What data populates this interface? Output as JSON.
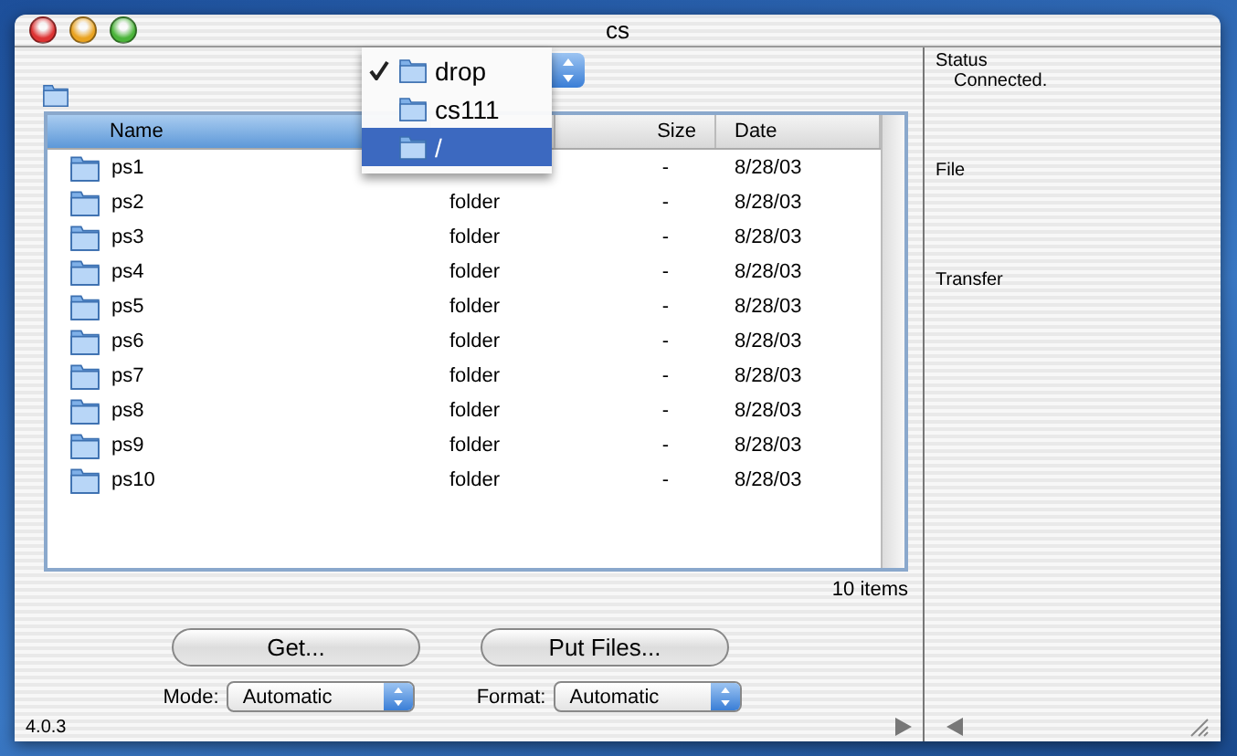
{
  "window": {
    "title": "cs"
  },
  "path_menu": [
    {
      "label": "drop",
      "checked": true,
      "selected": false
    },
    {
      "label": "cs111",
      "checked": false,
      "selected": false
    },
    {
      "label": "/",
      "checked": false,
      "selected": true
    }
  ],
  "table": {
    "columns": [
      "Name",
      "Size",
      "Date"
    ],
    "rows": [
      {
        "name": "ps1",
        "size": "-",
        "date": "8/28/03"
      },
      {
        "name": "ps2",
        "kind": "folder",
        "size": "-",
        "date": "8/28/03"
      },
      {
        "name": "ps3",
        "kind": "folder",
        "size": "-",
        "date": "8/28/03"
      },
      {
        "name": "ps4",
        "kind": "folder",
        "size": "-",
        "date": "8/28/03"
      },
      {
        "name": "ps5",
        "kind": "folder",
        "size": "-",
        "date": "8/28/03"
      },
      {
        "name": "ps6",
        "kind": "folder",
        "size": "-",
        "date": "8/28/03"
      },
      {
        "name": "ps7",
        "kind": "folder",
        "size": "-",
        "date": "8/28/03"
      },
      {
        "name": "ps8",
        "kind": "folder",
        "size": "-",
        "date": "8/28/03"
      },
      {
        "name": "ps9",
        "kind": "folder",
        "size": "-",
        "date": "8/28/03"
      },
      {
        "name": "ps10",
        "kind": "folder",
        "size": "-",
        "date": "8/28/03"
      }
    ]
  },
  "item_count": "10 items",
  "buttons": [
    "Get...",
    "Put Files..."
  ],
  "mode": {
    "label": "Mode:",
    "value": "Automatic"
  },
  "format": {
    "label": "Format:",
    "value": "Automatic"
  },
  "version": "4.0.3",
  "info": [
    {
      "label": "Status",
      "value": "Connected."
    },
    {
      "label": "File"
    },
    {
      "label": "Transfer"
    }
  ]
}
